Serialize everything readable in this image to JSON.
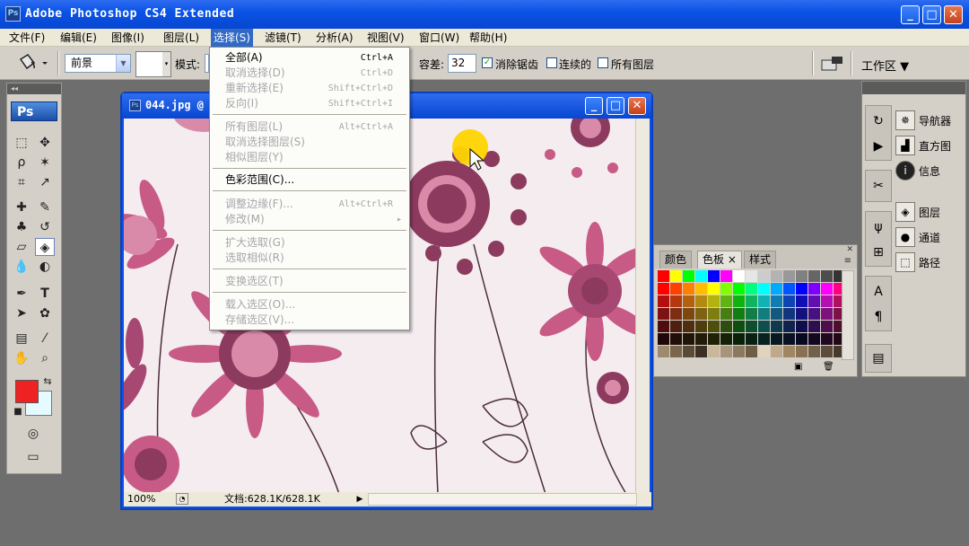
{
  "app": {
    "title": "Adobe Photoshop CS4 Extended",
    "logo": "Ps",
    "window_controls": {
      "minimize": "_",
      "maximize": "□",
      "close": "✕"
    }
  },
  "menubar": {
    "items": [
      "文件(F)",
      "编辑(E)",
      "图像(I)",
      "图层(L)",
      "选择(S)",
      "滤镜(T)",
      "分析(A)",
      "视图(V)",
      "窗口(W)",
      "帮助(H)"
    ],
    "active_index": 4
  },
  "options_bar": {
    "fill_source": "前景",
    "mode_label": "模式:",
    "tolerance_label": "容差:",
    "tolerance_value": "32",
    "antialias_label": "消除锯齿",
    "antialias_checked": true,
    "contiguous_label": "连续的",
    "contiguous_checked": false,
    "all_layers_label": "所有图层",
    "all_layers_checked": false,
    "workspace_label": "工作区 ▼"
  },
  "select_menu": {
    "items": [
      {
        "label": "全部(A)",
        "shortcut": "Ctrl+A",
        "enabled": true
      },
      {
        "label": "取消选择(D)",
        "shortcut": "Ctrl+D",
        "enabled": false
      },
      {
        "label": "重新选择(E)",
        "shortcut": "Shift+Ctrl+D",
        "enabled": false
      },
      {
        "label": "反向(I)",
        "shortcut": "Shift+Ctrl+I",
        "enabled": false
      },
      {
        "label": "所有图层(L)",
        "shortcut": "Alt+Ctrl+A",
        "enabled": false
      },
      {
        "label": "取消选择图层(S)",
        "shortcut": "",
        "enabled": false
      },
      {
        "label": "相似图层(Y)",
        "shortcut": "",
        "enabled": false
      },
      {
        "label": "色彩范围(C)...",
        "shortcut": "",
        "enabled": true
      },
      {
        "label": "调整边缘(F)...",
        "shortcut": "Alt+Ctrl+R",
        "enabled": false
      },
      {
        "label": "修改(M)",
        "shortcut": "▸",
        "enabled": false
      },
      {
        "label": "扩大选取(G)",
        "shortcut": "",
        "enabled": false
      },
      {
        "label": "选取相似(R)",
        "shortcut": "",
        "enabled": false
      },
      {
        "label": "变换选区(T)",
        "shortcut": "",
        "enabled": false
      },
      {
        "label": "载入选区(O)...",
        "shortcut": "",
        "enabled": false
      },
      {
        "label": "存储选区(V)...",
        "shortcut": "",
        "enabled": false
      }
    ]
  },
  "document": {
    "title": "044.jpg @",
    "zoom": "100%",
    "doc_size": "文档:628.1K/628.1K"
  },
  "toolbar": {
    "foreground_color": "#ee2222",
    "background_color": "#e6fbff"
  },
  "swatches_panel": {
    "tabs": [
      "颜色",
      "色板 ×",
      "样式"
    ],
    "active_tab": 1
  },
  "right_panels": {
    "items": [
      {
        "label": "导航器",
        "icon": "navigator-icon"
      },
      {
        "label": "直方图",
        "icon": "histogram-icon"
      },
      {
        "label": "信息",
        "icon": "info-icon"
      },
      {
        "label": "图层",
        "icon": "layers-icon"
      },
      {
        "label": "通道",
        "icon": "channels-icon"
      },
      {
        "label": "路径",
        "icon": "paths-icon"
      }
    ]
  },
  "colors": {
    "title_blue": "#0b53e6",
    "menu_highlight": "#316ac5",
    "flower_dark": "#8c3b5e",
    "flower_mid": "#c85a86",
    "flower_light": "#d98aa8",
    "canvas_bg": "#f5ecf0"
  }
}
